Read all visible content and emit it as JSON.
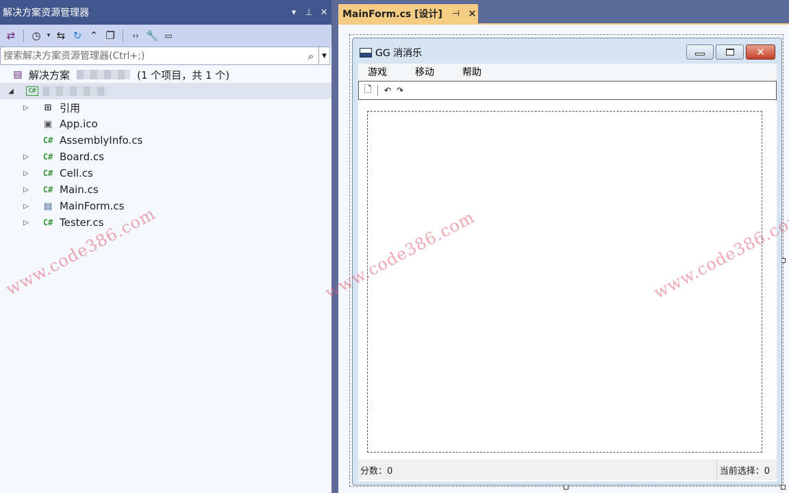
{
  "solution_explorer": {
    "title": "解决方案资源管理器",
    "title_controls": [
      "▾",
      "⊥",
      "✕"
    ],
    "search_placeholder": "搜索解决方案资源管理器(Ctrl+;)",
    "solution_label": "解决方案",
    "solution_info": "(1 个项目，共 1 个)",
    "items": [
      {
        "label": "引用",
        "icon": "references-icon"
      },
      {
        "label": "App.ico",
        "icon": "ico-file-icon"
      },
      {
        "label": "AssemblyInfo.cs",
        "icon": "csharp-file-icon"
      },
      {
        "label": "Board.cs",
        "icon": "csharp-file-icon"
      },
      {
        "label": "Cell.cs",
        "icon": "csharp-file-icon"
      },
      {
        "label": "Main.cs",
        "icon": "csharp-file-icon"
      },
      {
        "label": "MainForm.cs",
        "icon": "form-file-icon"
      },
      {
        "label": "Tester.cs",
        "icon": "csharp-file-icon"
      }
    ]
  },
  "document_tab": {
    "title": "MainForm.cs [设计]",
    "pin": "⊣",
    "close": "✕"
  },
  "form": {
    "title": "GG 消消乐",
    "menu": [
      "游戏",
      "移动",
      "帮助"
    ],
    "status_score": "分数：0",
    "status_selection": "当前选择：0"
  },
  "watermark": "www.code386.com",
  "colors": {
    "title_bar": "#40568d",
    "toolbar": "#ccd5f0",
    "tab_active": "#f5cc84",
    "panel_bg": "#f5f8fd",
    "csharp_green": "#3a9a3a"
  }
}
